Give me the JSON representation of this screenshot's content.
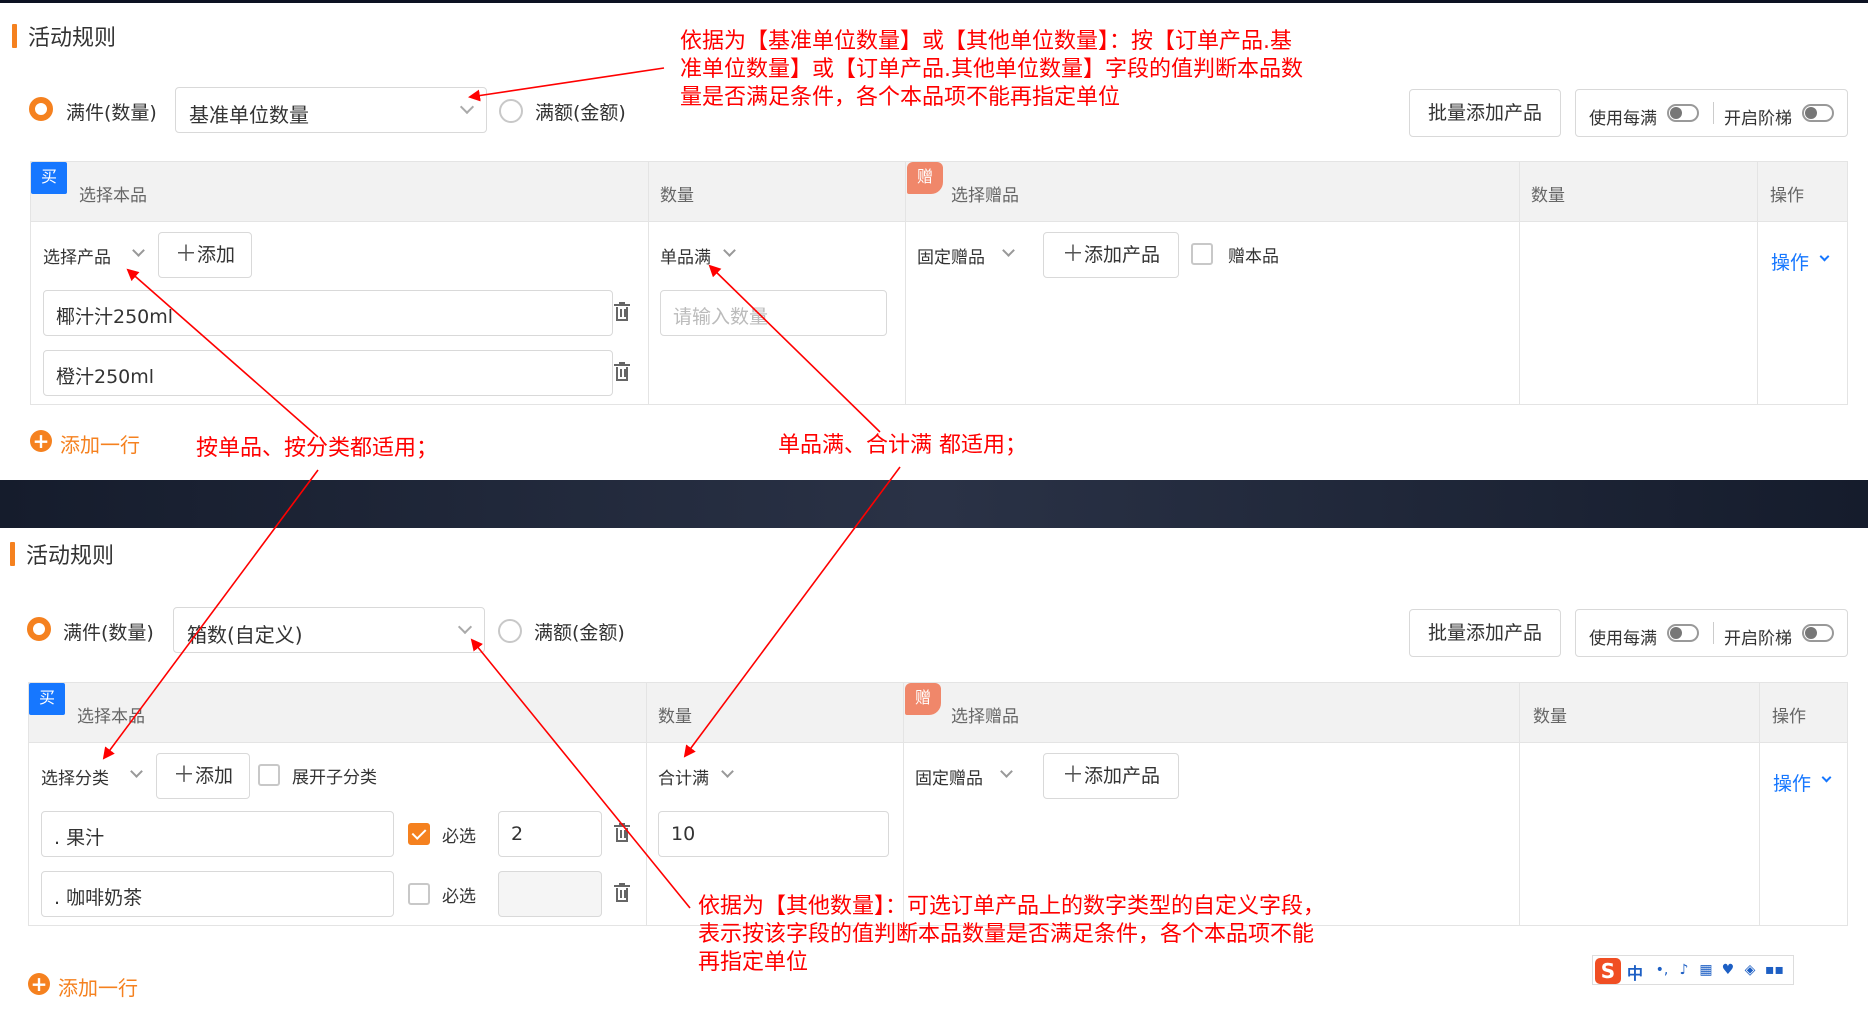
{
  "top": {
    "title": "活动规则",
    "radio_qty": "满件(数量)",
    "unit_select": "基准单位数量",
    "radio_amount": "满额(金额)",
    "bulk_add": "批量添加产品",
    "use_every": "使用每满",
    "open_tier": "开启阶梯",
    "head_select_product": "选择本品",
    "head_qty": "数量",
    "head_select_gift": "选择赠品",
    "head_qty2": "数量",
    "head_op": "操作",
    "badge_buy": "买",
    "badge_gift": "赠",
    "select_mode": "选择产品",
    "add_label": "添加",
    "products": [
      "椰汁汁250ml",
      "橙汁250ml"
    ],
    "condition": "单品满",
    "qty_placeholder": "请输入数量",
    "gift_mode": "固定赠品",
    "add_product": "添加产品",
    "gift_self": "赠本品",
    "op_link": "操作",
    "add_row": "添加一行"
  },
  "bottom": {
    "title": "活动规则",
    "radio_qty": "满件(数量)",
    "unit_select": "箱数(自定义)",
    "radio_amount": "满额(金额)",
    "bulk_add": "批量添加产品",
    "use_every": "使用每满",
    "open_tier": "开启阶梯",
    "head_select_product": "选择本品",
    "head_qty": "数量",
    "head_select_gift": "选择赠品",
    "head_qty2": "数量",
    "head_op": "操作",
    "badge_buy": "买",
    "badge_gift": "赠",
    "select_mode": "选择分类",
    "add_label": "添加",
    "expand_sub": "展开子分类",
    "categories": [
      {
        "name": ". 果汁",
        "required_label": "必选",
        "required": true,
        "qty": "2"
      },
      {
        "name": ". 咖啡奶茶",
        "required_label": "必选",
        "required": false,
        "qty": ""
      }
    ],
    "condition": "合计满",
    "qty_value": "10",
    "gift_mode": "固定赠品",
    "add_product": "添加产品",
    "op_link": "操作",
    "add_row": "添加一行"
  },
  "annotations": {
    "unit_note": [
      "依据为【基准单位数量】或【其他单位数量】：按【订单产品.基",
      "准单位数量】或【订单产品.其他单位数量】字段的值判断本品数",
      "量是否满足条件，各个本品项不能再指定单位"
    ],
    "scope_note": "按单品、按分类都适用；",
    "condition_note": "单品满、合计满 都适用；",
    "custom_note": [
      "依据为【其他数量】：可选订单产品上的数字类型的自定义字段，",
      "表示按该字段的值判断本品数量是否满足条件，各个本品项不能",
      "再指定单位"
    ]
  },
  "ime": {
    "logo": "S",
    "lang": "中"
  },
  "colors": {
    "accent": "#f5811f",
    "link": "#1677ff",
    "annotation": "#ff0000",
    "badge_buy": "#1677ff",
    "badge_gift": "#f0876a"
  }
}
